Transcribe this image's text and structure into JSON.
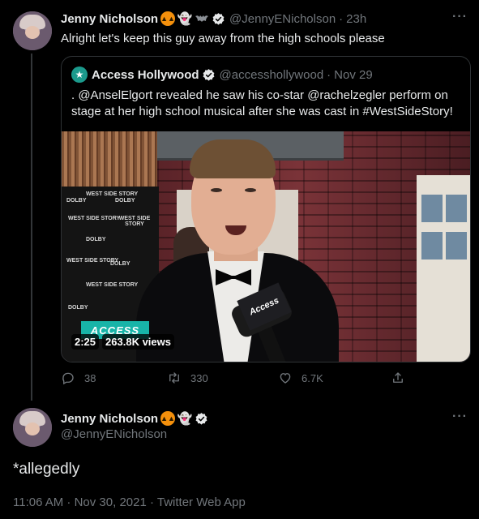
{
  "tweet": {
    "author_name": "Jenny Nicholson",
    "author_emoji": [
      "pumpkin",
      "ghost",
      "bat"
    ],
    "handle": "@JennyENicholson",
    "time": "23h",
    "separator": "·",
    "text": "Alright let's keep this guy away from the high schools please",
    "more": "···"
  },
  "quote": {
    "author_name": "Access Hollywood",
    "handle": "@accesshollywood",
    "time": "Nov 29",
    "separator": "·",
    "text": ". @AnselElgort revealed he saw his co-star @rachelzegler perform on stage at her high school musical after she was cast in #WestSideStory!",
    "video": {
      "duration": "2:25",
      "views": "263.8K views",
      "mic_flag_text": "Access",
      "brand_overlay": "ACCESS",
      "backdrop_logos": [
        "WEST SIDE STORY",
        "DOLBY"
      ]
    }
  },
  "actions": {
    "replies": "38",
    "retweets": "330",
    "likes": "6.7K"
  },
  "reply": {
    "author_name": "Jenny Nicholson",
    "author_emoji": [
      "pumpkin",
      "ghost"
    ],
    "handle": "@JennyENicholson",
    "text": "*allegedly",
    "meta": "11:06 AM · Nov 30, 2021 · Twitter Web App",
    "more": "···"
  },
  "colors": {
    "background": "#000000",
    "text": "#e7e9ea",
    "muted": "#71767b",
    "border": "#2f3336",
    "verified": "#1d9bf0"
  }
}
